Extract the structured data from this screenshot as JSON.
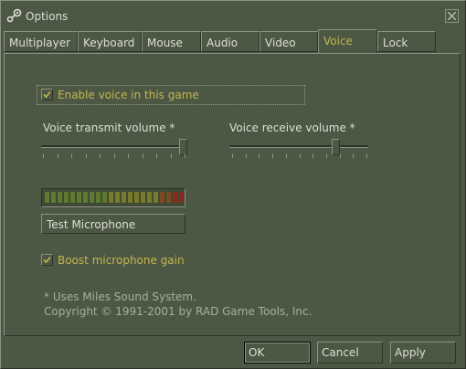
{
  "window": {
    "title": "Options"
  },
  "tabs": [
    {
      "label": "Multiplayer"
    },
    {
      "label": "Keyboard"
    },
    {
      "label": "Mouse"
    },
    {
      "label": "Audio"
    },
    {
      "label": "Video"
    },
    {
      "label": "Voice",
      "active": true
    },
    {
      "label": "Lock"
    }
  ],
  "voice": {
    "enable_voice": {
      "label": "Enable voice in this game",
      "checked": true
    },
    "transmit_volume": {
      "label": "Voice transmit volume *",
      "value": 1.0
    },
    "receive_volume": {
      "label": "Voice receive volume *",
      "value": 0.78
    },
    "meter": {
      "level_segments": 22,
      "colors": [
        "green",
        "yellow-green",
        "red"
      ]
    },
    "test_microphone": {
      "label": "Test Microphone"
    },
    "boost_gain": {
      "label": "Boost microphone gain",
      "checked": true
    },
    "footnote": {
      "line1": "* Uses Miles Sound System.",
      "line2": "Copyright © 1991-2001 by RAD Game Tools, Inc."
    }
  },
  "buttons": {
    "ok": "OK",
    "cancel": "Cancel",
    "apply": "Apply"
  },
  "colors": {
    "background": "#4c5844",
    "accent_text": "#c4b550",
    "text": "#dedfd6"
  }
}
